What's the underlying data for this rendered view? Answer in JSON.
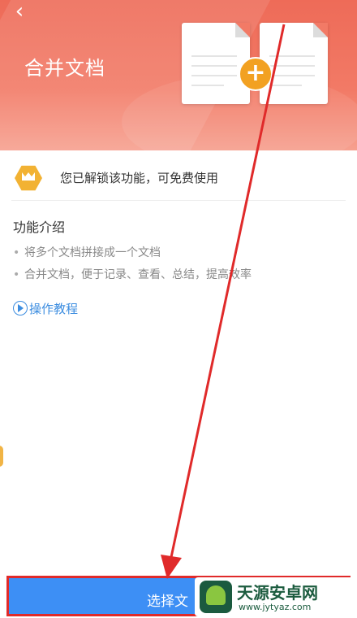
{
  "header": {
    "back_icon": "chevron-left-icon",
    "title": "合并文档"
  },
  "hero_art": {
    "plus_symbol": "+",
    "accent_color": "#f27a66",
    "badge_color": "#f2a122"
  },
  "unlock": {
    "icon": "crown-icon",
    "text": "您已解锁该功能，可免费使用"
  },
  "intro": {
    "title": "功能介绍",
    "items": [
      "将多个文档拼接成一个文档",
      "合并文档，便于记录、查看、总结，提高效率"
    ],
    "bullet": "•"
  },
  "tutorial": {
    "icon": "play-circle-icon",
    "label": "操作教程"
  },
  "action": {
    "label": "选择文",
    "color": "#3d8ff5",
    "highlight_color": "#e02a2a"
  },
  "watermark": {
    "title": "天源安卓网",
    "url": "www.jytyaz.com"
  }
}
